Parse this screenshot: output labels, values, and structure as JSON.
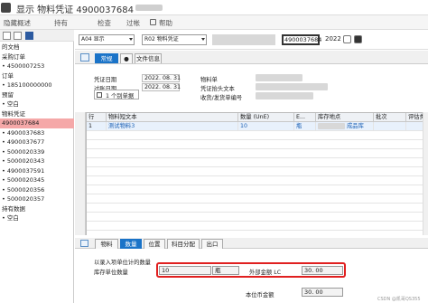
{
  "window": {
    "title": "显示 物料凭证 4900037684 -"
  },
  "menu": {
    "items": [
      "隐藏概述",
      "持有",
      "检查",
      "过帐",
      "帮助"
    ]
  },
  "left_panel": {
    "tree": [
      {
        "label": "的文档",
        "selected": false
      },
      {
        "label": "采购订单",
        "selected": false
      },
      {
        "label": "• 4500007253",
        "selected": false
      },
      {
        "label": "订单",
        "selected": false
      },
      {
        "label": "• 185100000000",
        "selected": false
      },
      {
        "label": "预留",
        "selected": false
      },
      {
        "label": "• 空白",
        "selected": false
      },
      {
        "label": "物料凭证",
        "selected": false
      },
      {
        "label": "4900037684",
        "selected": true
      },
      {
        "label": "• 4900037683",
        "selected": false
      },
      {
        "label": "• 4900037677",
        "selected": false
      },
      {
        "label": "• 5000020339",
        "selected": false
      },
      {
        "label": "• 5000020343",
        "selected": false
      },
      {
        "label": "• 4900037591",
        "selected": false
      },
      {
        "label": "• 5000020345",
        "selected": false
      },
      {
        "label": "• 5000020356",
        "selected": false
      },
      {
        "label": "• 5000020357",
        "selected": false
      },
      {
        "label": "持有数据",
        "selected": false
      },
      {
        "label": "• 空白",
        "selected": false
      }
    ]
  },
  "toolbar": {
    "action_value": "A04 显示",
    "ref_value": "R02 物料凭证",
    "doc_number": "4900037684",
    "year": "2022"
  },
  "header_tabs": [
    "常规",
    "文件信息"
  ],
  "header": {
    "doc_date_label": "凭证日期",
    "doc_date": "2022. 08. 31",
    "post_date_label": "过账日期",
    "post_date": "2022. 08. 31",
    "material_slip_label": "物料单",
    "header_text_label": "凭证抬头文本",
    "bill_label": "收货/发货单编号",
    "slip_count": "1 个别单据"
  },
  "grid": {
    "headers": [
      "行",
      "物料短文本",
      "数量 (UnE)",
      "E...",
      "库存地点",
      "批次",
      "评估类型"
    ],
    "rows": [
      {
        "line": "1",
        "material": "测试物料3",
        "qty": "10",
        "unit": "瓶",
        "location": "成品库"
      }
    ]
  },
  "item_tabs": [
    "物料",
    "数量",
    "位置",
    "科目分配",
    "出口"
  ],
  "detail": {
    "entry_qty_label": "以录入项单位计的数量",
    "stock_qty_label": "库存单位数量",
    "qty_value": "10",
    "qty_unit": "瓶",
    "ext_amount_label": "外部金额 LC",
    "ext_amount": "30. 00",
    "valuation_label": "本位币金额",
    "valuation": "30. 00"
  },
  "watermark": "CSDN @凯哥QS355"
}
